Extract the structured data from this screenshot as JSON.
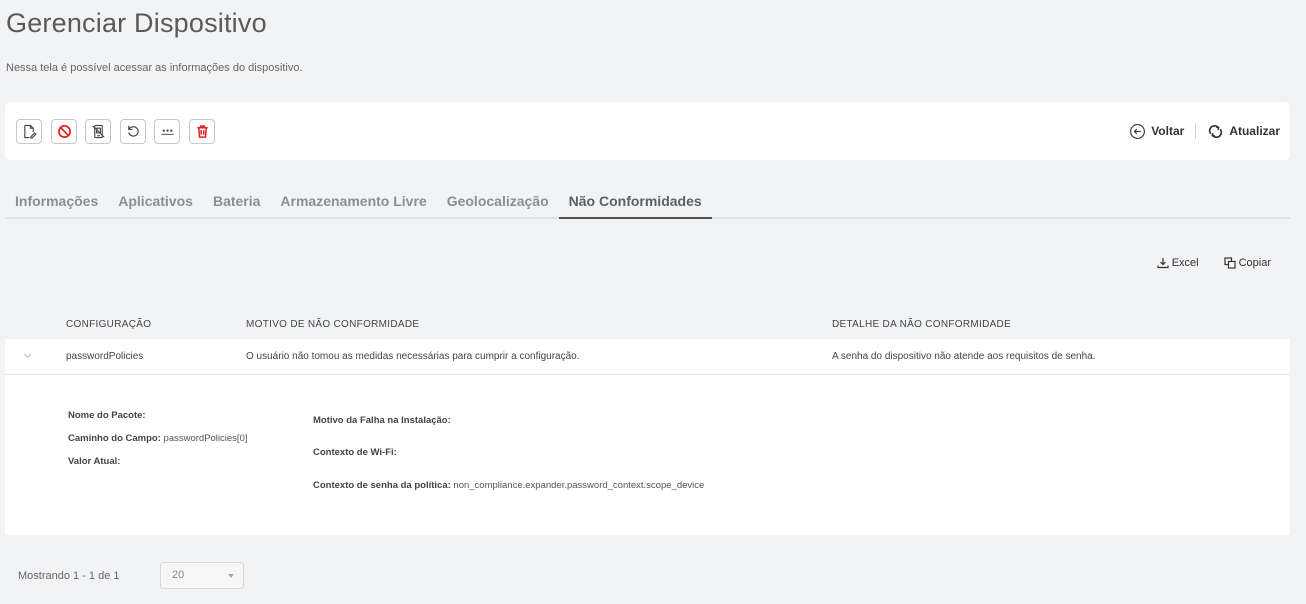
{
  "header": {
    "title": "Gerenciar Dispositivo",
    "subtitle": "Nessa tela é possível acessar as informações do dispositivo."
  },
  "toolbar": {
    "icons": [
      "edit-device-icon",
      "block-icon",
      "disable-device-icon",
      "reset-icon",
      "password-icon",
      "delete-icon"
    ],
    "back_label": "Voltar",
    "refresh_label": "Atualizar"
  },
  "tabs": [
    {
      "label": "Informações"
    },
    {
      "label": "Aplicativos"
    },
    {
      "label": "Bateria"
    },
    {
      "label": "Armazenamento Livre"
    },
    {
      "label": "Geolocalização"
    },
    {
      "label": "Não Conformidades",
      "active": true
    }
  ],
  "export": {
    "excel_label": "Excel",
    "copy_label": "Copiar"
  },
  "grid": {
    "columns": [
      "CONFIGURAÇÃO",
      "MOTIVO DE NÃO CONFORMIDADE",
      "DETALHE DA NÃO CONFORMIDADE"
    ],
    "rows": [
      {
        "configuracao": "passwordPolicies",
        "motivo": "O usuário não tomou as medidas necessárias para cumprir a configuração.",
        "detalhe": "A senha do dispositivo não atende aos requisitos de senha."
      }
    ]
  },
  "detail": {
    "pacote_label": "Nome do Pacote:",
    "pacote_value": "",
    "caminho_label": "Caminho do Campo:",
    "caminho_value": "passwordPolicies[0]",
    "valor_label": "Valor Atual:",
    "valor_value": "",
    "falha_label": "Motivo da Falha na Instalação:",
    "falha_value": "",
    "wifi_label": "Contexto de Wi-Fi:",
    "wifi_value": "",
    "senha_label": "Contexto de senha da política:",
    "senha_value": "non_compliance.expander.password_context.scope_device"
  },
  "pager": {
    "text": "Mostrando 1 - 1 de 1",
    "page_size": "20"
  },
  "colors": {
    "danger": "#e02020",
    "text": "#333333",
    "background": "#f2f3f5"
  }
}
